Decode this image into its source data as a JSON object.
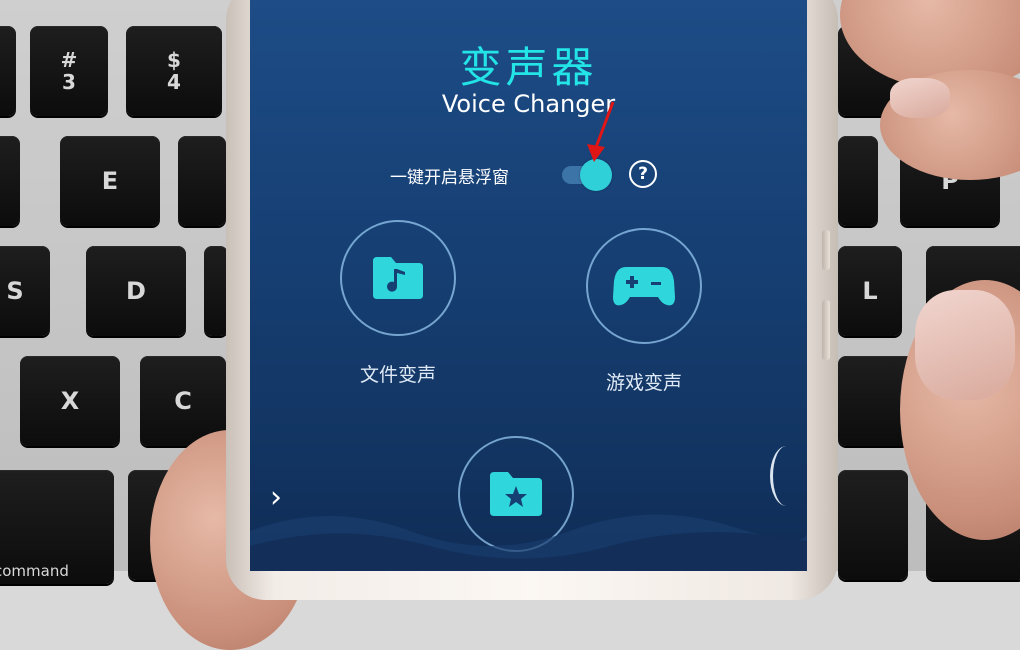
{
  "keyboard": {
    "keys": [
      "#",
      "3",
      "$",
      "4",
      "E",
      "D",
      "S",
      "X",
      "C",
      "P",
      "L",
      "command"
    ]
  },
  "app": {
    "title_cn": "变声器",
    "title_en": "Voice Changer",
    "floating_window_label": "一键开启悬浮窗",
    "floating_window_enabled": true,
    "help_icon_label": "?",
    "features": [
      {
        "label": "文件变声",
        "icon": "music-folder-icon"
      },
      {
        "label": "游戏变声",
        "icon": "gamepad-icon"
      },
      {
        "label": "",
        "icon": "star-folder-icon"
      }
    ],
    "nav_chevron": "›"
  },
  "colors": {
    "accent": "#23e4e6",
    "icon_fill": "#2fd7dc",
    "background_top": "#1d4c86",
    "arrow": "#e01515"
  }
}
